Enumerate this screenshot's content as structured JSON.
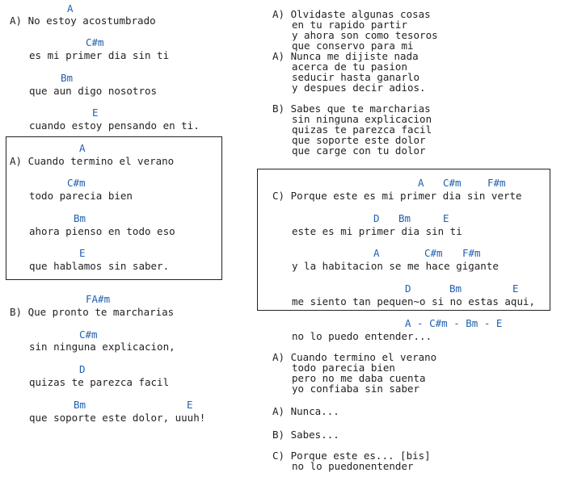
{
  "left": {
    "v1": {
      "c1": "A",
      "l1": "A) No estoy acostumbrado",
      "c2": "C#m",
      "l2": "es mi primer dia sin ti",
      "c3": "Bm",
      "l3": "que aun digo nosotros",
      "c4": "E",
      "l4": "cuando estoy pensando en ti."
    },
    "v2": {
      "c1": "A",
      "l1": "A) Cuando termino el verano",
      "c2": "C#m",
      "l2": "todo parecia bien",
      "c3": "Bm",
      "l3": "ahora pienso en todo eso",
      "c4": "E",
      "l4": "que hablamos sin saber."
    },
    "v3": {
      "c1": "FA#m",
      "l1": "B) Que pronto te marcharias",
      "c2": "C#m",
      "l2": "sin ninguna explicacion,",
      "c3": "D",
      "l3": "quizas te parezca facil",
      "c4a": "Bm",
      "c4b": "E",
      "l4": "que soporte este dolor, uuuh!"
    }
  },
  "right": {
    "a1": [
      "A) Olvidaste algunas cosas",
      "en tu rapido partir",
      "y ahora son como tesoros",
      "que conservo para mi"
    ],
    "a2": [
      "A) Nunca me dijiste nada",
      "acerca de tu pasion",
      "seducir hasta ganarlo",
      "y despues decir adios."
    ],
    "b1": [
      "B) Sabes que te marcharias",
      "sin ninguna explicacion",
      "quizas te parezca facil",
      "que soporte este dolor",
      "que carge con tu dolor"
    ],
    "chorus": {
      "c1": [
        "A",
        "C#m",
        "F#m"
      ],
      "l1": "C) Porque este es mi primer dia sin verte",
      "c2": [
        "D",
        "Bm",
        "E"
      ],
      "l2": "este es mi primer dia sin ti",
      "c3": [
        "A",
        "C#m",
        "F#m"
      ],
      "l3": "y la habitacion se me hace gigante",
      "c4": [
        "D",
        "Bm",
        "E"
      ],
      "l4": "me siento tan pequen~o si no estas aqui,"
    },
    "outro_chords": "A - C#m - Bm - E",
    "outro_line": "no lo puedo entender...",
    "a3": [
      "A) Cuando termino el verano",
      "todo parecia bien",
      "pero no me daba cuenta",
      "yo confiaba sin saber"
    ],
    "nunca": "A) Nunca...",
    "sabes": "B) Sabes...",
    "c_end": [
      "C) Porque este es... [bis]",
      "no lo puedonentender"
    ]
  }
}
